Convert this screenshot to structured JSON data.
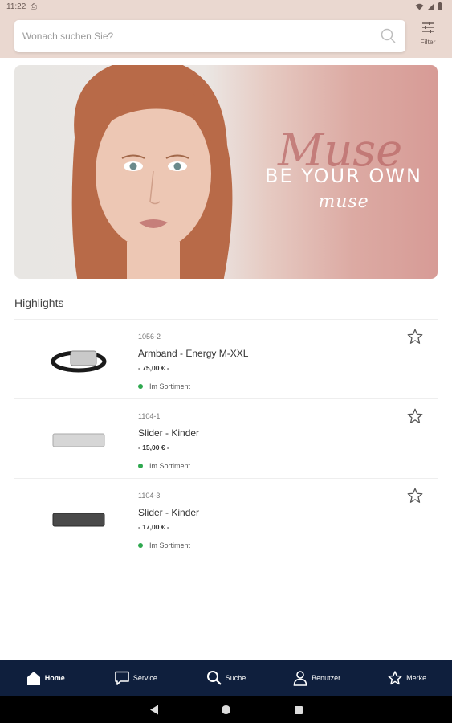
{
  "status_bar": {
    "time": "11:22",
    "notification": "⎙"
  },
  "search": {
    "placeholder": "Wonach suchen Sie?",
    "value": ""
  },
  "filter": {
    "label": "Filter"
  },
  "banner": {
    "title": "BE YOUR OWN",
    "subtitle": "muse",
    "logo_text": "Muse"
  },
  "highlights": {
    "title": "Highlights",
    "products": [
      {
        "code": "1056-2",
        "name": "Armband - Energy M-XXL",
        "price": "- 75,00 € -",
        "availability": "Im Sortiment",
        "image": "bracelet-icon"
      },
      {
        "code": "1104-1",
        "name": "Slider - Kinder",
        "price": "- 15,00 € -",
        "availability": "Im Sortiment",
        "image": "slider-silver-icon"
      },
      {
        "code": "1104-3",
        "name": "Slider - Kinder",
        "price": "- 17,00 € -",
        "availability": "Im Sortiment",
        "image": "slider-dark-icon"
      }
    ]
  },
  "bottom_nav": {
    "items": [
      {
        "label": "Home",
        "icon": "home-icon",
        "active": true
      },
      {
        "label": "Service",
        "icon": "chat-icon",
        "active": false
      },
      {
        "label": "Suche",
        "icon": "search-icon",
        "active": false
      },
      {
        "label": "Benutzer",
        "icon": "user-icon",
        "active": false
      },
      {
        "label": "Merke",
        "icon": "star-icon",
        "active": false
      }
    ]
  },
  "colors": {
    "header_bg": "#ead8d0",
    "nav_bg": "#0f1f3d",
    "in_stock": "#2fa84f",
    "banner_accent": "#d79b96"
  }
}
